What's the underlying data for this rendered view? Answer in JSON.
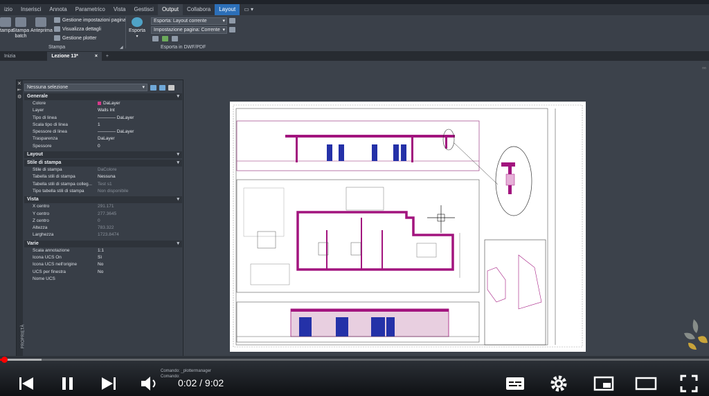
{
  "ribbon_tabs": [
    "izio",
    "Inserisci",
    "Annota",
    "Parametrico",
    "Vista",
    "Gestisci",
    "Output",
    "Collabora",
    "Layout"
  ],
  "ribbon": {
    "plot_label": "tampa",
    "batch_label_1": "Stampa",
    "batch_label_2": "batch",
    "preview_label": "Anteprima",
    "page_setup_manager": "Gestione impostazioni pagina",
    "view_details": "Visualizza dettagli",
    "plotter_manager": "Gestione plotter",
    "group_stampa": "Stampa",
    "export_label": "Esporta",
    "export_layout": "Esporta: Layout corrente",
    "page_setup": "Impostazione pagina: Corrente",
    "group_export": "Esporta in DWF/PDF"
  },
  "doc_tabs": {
    "start": "Inizia",
    "current": "Lezione 13*",
    "close": "×",
    "add": "+"
  },
  "properties": {
    "selection": "Nessuna selezione",
    "sections": [
      {
        "title": "Generale",
        "rows": [
          {
            "name": "Colore",
            "value": "DaLayer"
          },
          {
            "name": "Layer",
            "value": "Walls Int"
          },
          {
            "name": "Tipo di linea",
            "value": "———— DaLayer"
          },
          {
            "name": "Scala tipo di linea",
            "value": "1"
          },
          {
            "name": "Spessore di linea",
            "value": "———— DaLayer"
          },
          {
            "name": "Trasparenza",
            "value": "DaLayer"
          },
          {
            "name": "Spessore",
            "value": "0"
          }
        ]
      },
      {
        "title": "Layout",
        "rows": []
      },
      {
        "title": "Stile di stampa",
        "rows": [
          {
            "name": "Stile di stampa",
            "value": "DaColore"
          },
          {
            "name": "Tabella stili di stampa",
            "value": "Nessuna"
          },
          {
            "name": "Tabella stili di stampa colleg...",
            "value": "Test s1"
          },
          {
            "name": "Tipo tabella stili di stampa",
            "value": "Non disponibile"
          }
        ]
      },
      {
        "title": "Vista",
        "rows": [
          {
            "name": "X centro",
            "value": "291.171"
          },
          {
            "name": "Y centro",
            "value": "277.3645"
          },
          {
            "name": "Z centro",
            "value": "0"
          },
          {
            "name": "Altezza",
            "value": "783.322"
          },
          {
            "name": "Larghezza",
            "value": "1723.8474"
          }
        ]
      },
      {
        "title": "Varie",
        "rows": [
          {
            "name": "Scala annotazione",
            "value": "1:1"
          },
          {
            "name": "Icona UCS On",
            "value": "Sì"
          },
          {
            "name": "Icona UCS nell'origine",
            "value": "No"
          },
          {
            "name": "UCS per finestra",
            "value": "No"
          },
          {
            "name": "Nome UCS",
            "value": ""
          }
        ]
      }
    ],
    "side_label": "PROPRIETÀ"
  },
  "command_line": [
    "Comando: _plottermanager",
    "Comando:"
  ],
  "player": {
    "time": "0:02 / 9:02",
    "progress_fraction": 0.004
  },
  "colors": {
    "accent": "#2c6fb8",
    "wall": "#a2147e",
    "progress": "#ff0000"
  }
}
